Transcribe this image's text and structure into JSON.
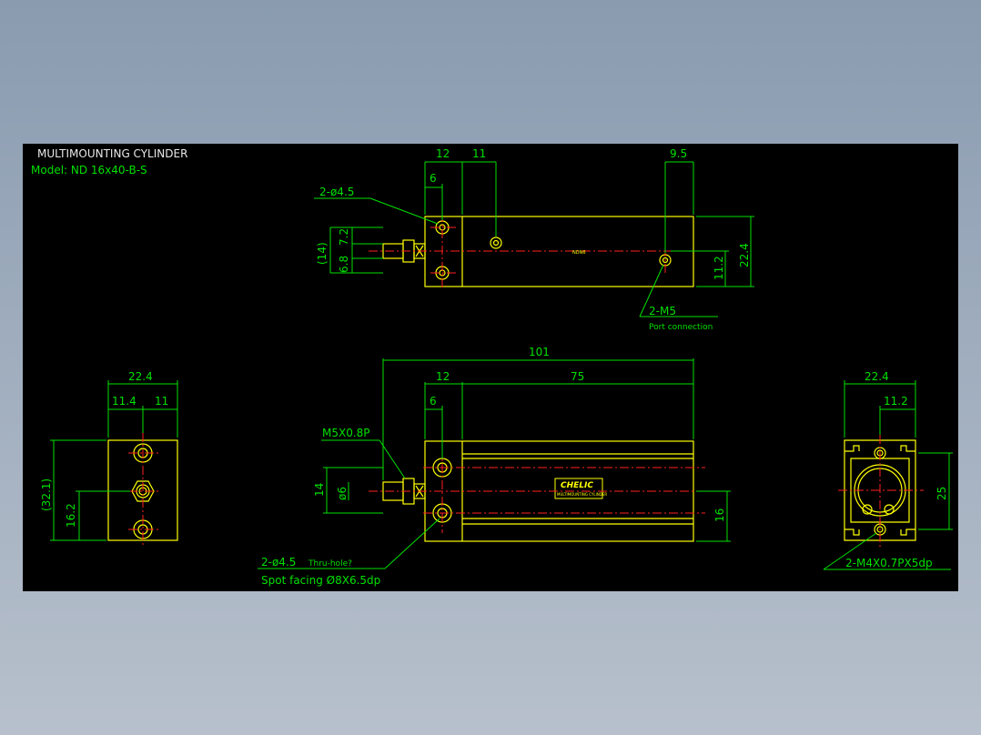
{
  "title": {
    "name": "MULTIMOUNTING CYLINDER",
    "model": "Model: ND 16x40-B-S"
  },
  "top_view": {
    "dims": {
      "d12": "12",
      "d11": "11",
      "d6": "6",
      "d9_5": "9.5",
      "paren14": "(14)",
      "d6_8": "6.8",
      "d7_2": "7.2",
      "d11_2": "11.2",
      "d22_4": "22.4"
    },
    "callout_hole": "2-ø4.5",
    "callout_port": "2-M5",
    "port_note": "Port connection"
  },
  "front_view": {
    "dims": {
      "d101": "101",
      "d12": "12",
      "d75": "75",
      "d6": "6",
      "d14": "14",
      "phi6": "ø6",
      "d16": "16"
    },
    "thread": "M5X0.8P",
    "callout_hole": "2-ø4.5",
    "thru_note": "Thru-hole?",
    "spot_facing": "Spot facing  Ø8X6.5dp",
    "badge": "CHELIC",
    "badge_sub": "MULTIMOUNTING CYLINDER"
  },
  "left_view": {
    "dims": {
      "d22_4": "22.4",
      "d11_4": "11.4",
      "d11": "11",
      "d32_1": "(32.1)",
      "d16_2": "16.2"
    }
  },
  "right_view": {
    "dims": {
      "d22_4": "22.4",
      "d11_2": "11.2",
      "d25": "25"
    },
    "callout": "2-M4X0.7PX5dp"
  },
  "colors": {
    "dimension": "#00e000",
    "object": "#ffff00",
    "center": "#ff2020",
    "title_text": "#e8e8e8",
    "background": "#000000"
  }
}
